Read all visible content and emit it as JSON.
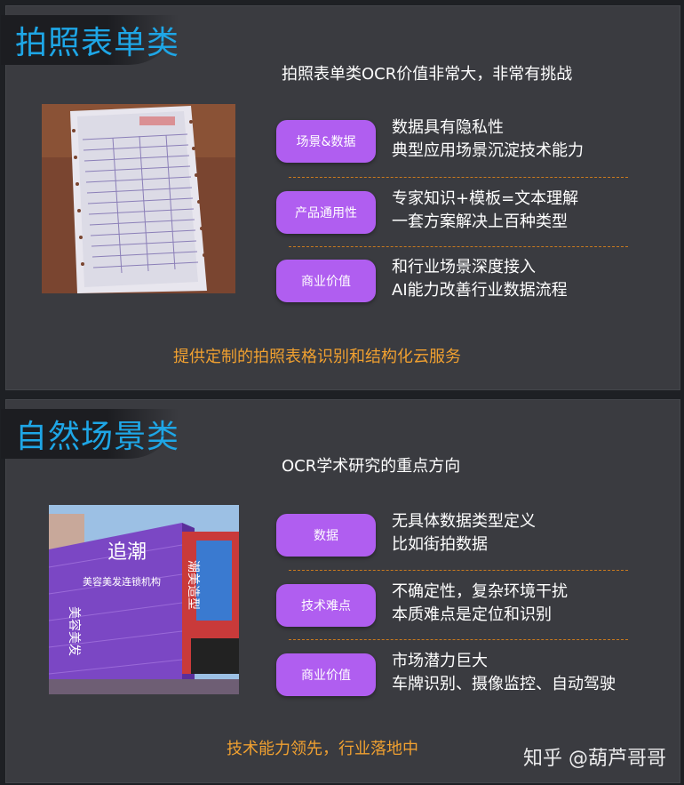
{
  "section1": {
    "title": "拍照表单类",
    "subtitle": "拍照表单类OCR价值非常大，非常有挑战",
    "rows": [
      {
        "label": "场景&数据",
        "lines": [
          "数据具有隐私性",
          "典型应用场景沉淀技术能力"
        ]
      },
      {
        "label": "产品通用性",
        "lines": [
          "专家知识+模板=文本理解",
          "一套方案解决上百种类型"
        ]
      },
      {
        "label": "商业价值",
        "lines": [
          "和行业场景深度接入",
          "AI能力改善行业数据流程"
        ]
      }
    ],
    "footer": "提供定制的拍照表格识别和结构化云服务"
  },
  "section2": {
    "title": "自然场景类",
    "subtitle": "OCR学术研究的重点方向",
    "rows": [
      {
        "label": "数据",
        "lines": [
          "无具体数据类型定义",
          "比如街拍数据"
        ]
      },
      {
        "label": "技术难点",
        "lines": [
          "不确定性，复杂环境干扰",
          "本质难点是定位和识别"
        ]
      },
      {
        "label": "商业价值",
        "lines": [
          "市场潜力巨大",
          "车牌识别、摄像监控、自动驾驶"
        ]
      }
    ],
    "footer": "技术能力领先，行业落地中",
    "photo_sign": {
      "main": "追潮",
      "sub": "美容美发连锁机构",
      "side": "美容美发",
      "shop": "潮美造型"
    }
  },
  "watermark": "知乎 @葫芦哥哥",
  "colors": {
    "accent_title": "#1ea6e6",
    "pill": "#b05ef0",
    "footer": "#f0a030",
    "panel": "#3a3b40"
  }
}
